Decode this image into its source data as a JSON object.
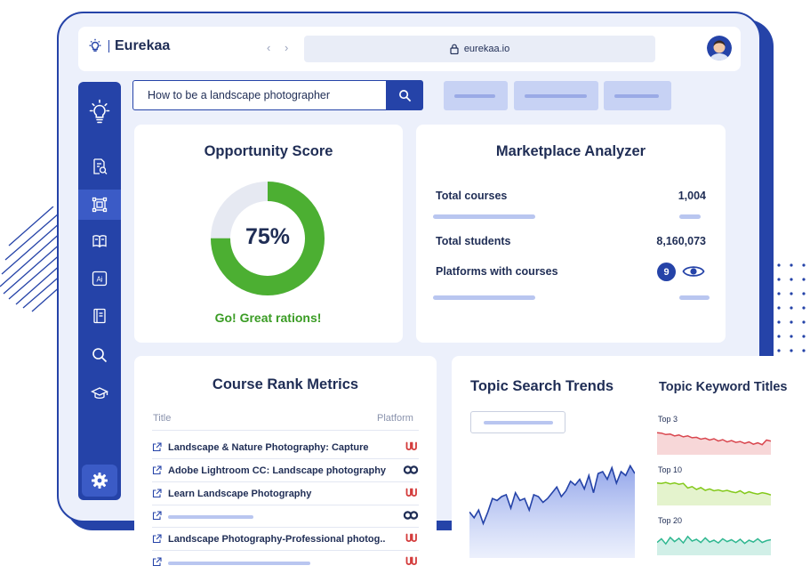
{
  "app": {
    "name": "Eurekaa",
    "url": "eurekaa.io"
  },
  "search": {
    "query": "How to be a landscape photographer"
  },
  "opportunity": {
    "title": "Opportunity Score",
    "score_label": "75%",
    "score_fraction": 0.75,
    "caption": "Go! Great rations!",
    "colors": {
      "fill": "#4caf32",
      "track": "#e6e9f2"
    }
  },
  "marketplace": {
    "title": "Marketplace Analyzer",
    "total_courses_label": "Total courses",
    "total_courses_value": "1,004",
    "total_students_label": "Total students",
    "total_students_value": "8,160,073",
    "platforms_label": "Platforms with courses",
    "platforms_count": "9"
  },
  "rank": {
    "title": "Course Rank Metrics",
    "col_title": "Title",
    "col_platform": "Platform",
    "rows": [
      {
        "title": "Landscape & Nature Photography: Capture",
        "platform": "udemy"
      },
      {
        "title": "Adobe Lightroom CC: Landscape photography",
        "platform": "coursera"
      },
      {
        "title": "Learn Landscape Photography",
        "platform": "udemy"
      },
      {
        "title": "",
        "platform": "coursera"
      },
      {
        "title": "Landscape Photography-Professional photog..",
        "platform": "udemy"
      },
      {
        "title": "",
        "platform": "udemy"
      }
    ]
  },
  "trends": {
    "title": "Topic Search Trends",
    "series": [
      46,
      40,
      48,
      34,
      46,
      60,
      58,
      62,
      64,
      50,
      66,
      58,
      60,
      48,
      64,
      62,
      56,
      60,
      66,
      72,
      62,
      68,
      78,
      74,
      80,
      70,
      84,
      66,
      86,
      88,
      80,
      92,
      76,
      88,
      84,
      94,
      86
    ]
  },
  "keywords": {
    "title": "Topic Keyword Titles",
    "top3_label": "Top 3",
    "top10_label": "Top 10",
    "top20_label": "Top 20",
    "top3": [
      80,
      78,
      72,
      74,
      66,
      70,
      62,
      66,
      58,
      60,
      52,
      56,
      48,
      54,
      44,
      50,
      40,
      46,
      38,
      42,
      34,
      40,
      30,
      36,
      28,
      48,
      44
    ],
    "top10": [
      82,
      80,
      84,
      78,
      82,
      76,
      80,
      60,
      66,
      54,
      62,
      50,
      56,
      48,
      52,
      46,
      50,
      44,
      40,
      48,
      36,
      44,
      38,
      34,
      40,
      36,
      30
    ],
    "top20": [
      40,
      56,
      34,
      62,
      44,
      58,
      38,
      66,
      46,
      54,
      40,
      60,
      42,
      50,
      38,
      56,
      44,
      52,
      40,
      54,
      36,
      50,
      42,
      56,
      40,
      48,
      52
    ],
    "colors": {
      "top3": "#d9474f",
      "top10": "#84c91c",
      "top20": "#2fb790"
    }
  },
  "colors": {
    "primary": "#2543a8",
    "accent_green": "#3a9c24",
    "platform_red": "#d33a3a"
  }
}
